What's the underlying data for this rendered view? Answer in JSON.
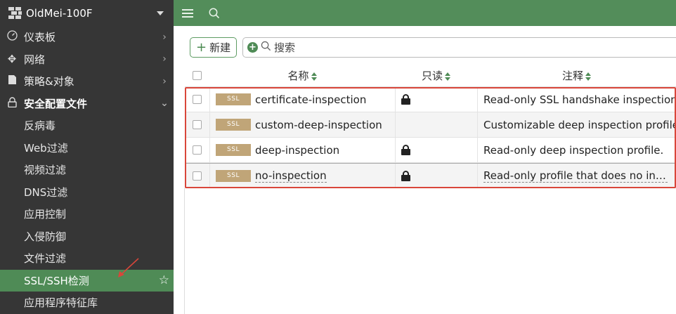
{
  "device": {
    "name": "OldMei-100F"
  },
  "sidebar": {
    "items": [
      {
        "label": "仪表板",
        "icon": "dashboard-icon"
      },
      {
        "label": "网络",
        "icon": "network-move-icon"
      },
      {
        "label": "策略&对象",
        "icon": "policy-doc-icon"
      },
      {
        "label": "安全配置文件",
        "icon": "lock-icon"
      }
    ],
    "sub_items": [
      {
        "label": "反病毒"
      },
      {
        "label": "Web过滤"
      },
      {
        "label": "视频过滤"
      },
      {
        "label": "DNS过滤"
      },
      {
        "label": "应用控制"
      },
      {
        "label": "入侵防御"
      },
      {
        "label": "文件过滤"
      },
      {
        "label": "SSL/SSH检测",
        "active": true
      },
      {
        "label": "应用程序特征库"
      }
    ]
  },
  "toolbar": {
    "new_label": "新建",
    "search_placeholder": "搜索"
  },
  "table": {
    "headers": {
      "name": "名称",
      "readonly": "只读",
      "comment": "注释"
    },
    "tag": "SSL",
    "rows": [
      {
        "name": "certificate-inspection",
        "readonly": true,
        "comment": "Read-only SSL handshake inspection profile."
      },
      {
        "name": "custom-deep-inspection",
        "readonly": false,
        "comment": "Customizable deep inspection profile."
      },
      {
        "name": "deep-inspection",
        "readonly": true,
        "comment": "Read-only deep inspection profile."
      },
      {
        "name": "no-inspection",
        "readonly": true,
        "comment": "Read-only profile that does no inspection."
      }
    ]
  },
  "colors": {
    "brand_green": "#538d5a",
    "sidebar_bg": "#363636",
    "ssl_tag": "#c0a578",
    "highlight_red": "#d9463a"
  }
}
